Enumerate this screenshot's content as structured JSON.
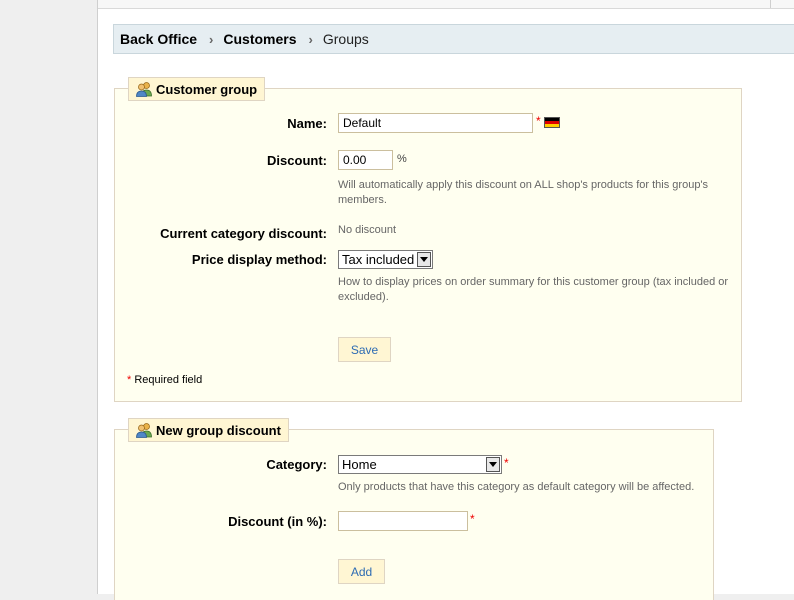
{
  "breadcrumb": {
    "items": [
      "Back Office",
      "Customers"
    ],
    "current": "Groups",
    "separator": "›"
  },
  "customer_group": {
    "legend": "Customer group",
    "name_label": "Name:",
    "name_value": "Default",
    "discount_label": "Discount:",
    "discount_value": "0.00",
    "discount_unit": "%",
    "discount_hint_line1": "Will automatically apply this discount on ALL shop's products for this group's",
    "discount_hint_line2": "members.",
    "current_category_discount_label": "Current category discount:",
    "current_category_discount_value": "No discount",
    "price_display_label": "Price display method:",
    "price_display_value": "Tax included",
    "price_display_hint_line1": "How to display prices on order summary for this customer group (tax included or",
    "price_display_hint_line2": "excluded).",
    "save_label": "Save",
    "required_marker": "*",
    "required_note": "Required field"
  },
  "new_group_discount": {
    "legend": "New group discount",
    "category_label": "Category:",
    "category_value": "Home",
    "category_hint": "Only products that have this category as default category will be affected.",
    "discount_label": "Discount (in %):",
    "discount_value": "",
    "add_label": "Add"
  },
  "colors": {
    "panel_bg": "#fffff0",
    "panel_border": "#dfd5c3",
    "legend_bg": "#fff6d3",
    "button_text": "#2d6bb3",
    "required": "#ee0000",
    "breadcrumb_bg": "#e6eef2"
  },
  "icons": {
    "legend": "users-icon",
    "flag": "german-flag-icon",
    "breadcrumb_sep": "chevron-right-icon",
    "select_arrow": "chevron-down-icon"
  }
}
